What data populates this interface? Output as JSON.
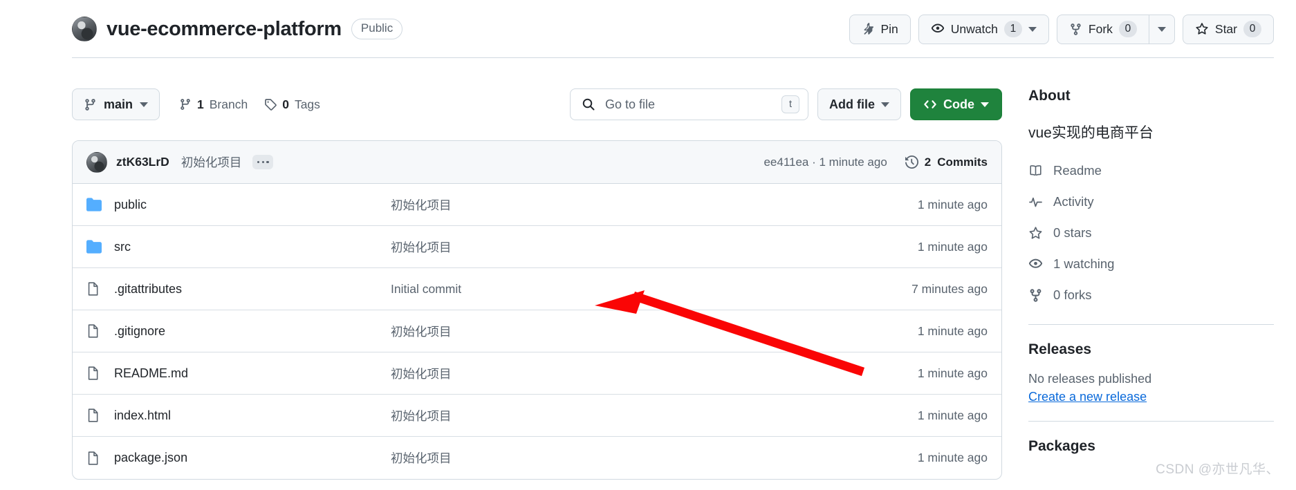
{
  "header": {
    "repo_name": "vue-ecommerce-platform",
    "visibility": "Public",
    "avatar_icon": "owner-avatar-image",
    "actions": {
      "pin_label": "Pin",
      "pin_icon": "pin-icon",
      "watch_label": "Unwatch",
      "watch_count": "1",
      "watch_icon": "eye-icon",
      "fork_label": "Fork",
      "fork_count": "0",
      "fork_icon": "repo-forked-icon",
      "star_label": "Star",
      "star_count": "0",
      "star_icon": "star-icon"
    }
  },
  "toolbar": {
    "branch_name": "main",
    "branch_icon": "git-branch-icon",
    "branch_count_label": "1 Branch",
    "branch_count_value": "1",
    "branch_count_text": "Branch",
    "tag_count_value": "0",
    "tag_count_text": "Tags",
    "tag_icon": "tag-icon",
    "search_placeholder": "Go to file",
    "search_value": "",
    "search_icon": "search-icon",
    "search_shortcut": "t",
    "add_file_label": "Add file",
    "code_label": "Code",
    "code_icon": "code-brackets-icon",
    "code_color": "#1f833d"
  },
  "commit_bar": {
    "author": "ztK63LrD",
    "message": "初始化项目",
    "sha_and_time": "ee411ea · 1 minute ago",
    "commits_count": "2",
    "commits_label": "Commits",
    "history_icon": "history-clock-icon",
    "more_icon": "ellipsis-icon"
  },
  "files": [
    {
      "name": "public",
      "type": "folder",
      "icon": "folder-icon",
      "message": "初始化项目",
      "time": "1 minute ago"
    },
    {
      "name": "src",
      "type": "folder",
      "icon": "folder-icon",
      "message": "初始化项目",
      "time": "1 minute ago"
    },
    {
      "name": ".gitattributes",
      "type": "file",
      "icon": "file-icon",
      "message": "Initial commit",
      "time": "7 minutes ago"
    },
    {
      "name": ".gitignore",
      "type": "file",
      "icon": "file-icon",
      "message": "初始化项目",
      "time": "1 minute ago"
    },
    {
      "name": "README.md",
      "type": "file",
      "icon": "file-icon",
      "message": "初始化项目",
      "time": "1 minute ago"
    },
    {
      "name": "index.html",
      "type": "file",
      "icon": "file-icon",
      "message": "初始化项目",
      "time": "1 minute ago"
    },
    {
      "name": "package.json",
      "type": "file",
      "icon": "file-icon",
      "message": "初始化项目",
      "time": "1 minute ago"
    }
  ],
  "sidebar": {
    "about_title": "About",
    "description": "vue实现的电商平台",
    "links": [
      {
        "label": "Readme",
        "icon": "book-icon"
      },
      {
        "label": "Activity",
        "icon": "pulse-icon"
      },
      {
        "label": "0 stars",
        "icon": "star-icon"
      },
      {
        "label": "1 watching",
        "icon": "eye-icon"
      },
      {
        "label": "0 forks",
        "icon": "repo-forked-icon"
      }
    ],
    "releases_title": "Releases",
    "releases_empty": "No releases published",
    "releases_link": "Create a new release",
    "packages_title": "Packages"
  },
  "annotation": {
    "arrow_color": "#fa0505"
  },
  "watermark": "CSDN @亦世凡华、"
}
